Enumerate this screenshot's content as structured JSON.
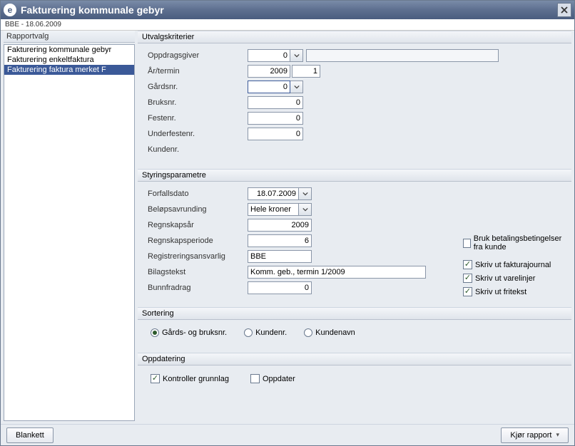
{
  "title": "Fakturering kommunale gebyr",
  "status": "BBE - 18.06.2009",
  "left": {
    "header": "Rapportvalg",
    "items": [
      "Fakturering kommunale gebyr",
      "Fakturering enkeltfaktura",
      "Fakturering faktura merket F"
    ],
    "selected_index": 2
  },
  "utvalg": {
    "title": "Utvalgskriterier",
    "labels": {
      "oppdragsgiver": "Oppdragsgiver",
      "aar_termin": "År/termin",
      "gardsnr": "Gårdsnr.",
      "bruksnr": "Bruksnr.",
      "festenr": "Festenr.",
      "underfestenr": "Underfestenr.",
      "kundenr": "Kundenr."
    },
    "values": {
      "oppdragsgiver": "0",
      "aar": "2009",
      "termin": "1",
      "gardsnr": "0",
      "bruksnr": "0",
      "festenr": "0",
      "underfestenr": "0"
    }
  },
  "styring": {
    "title": "Styringsparametre",
    "labels": {
      "forfallsdato": "Forfallsdato",
      "belopsavrunding": "Beløpsavrunding",
      "regnskapsaar": "Regnskapsår",
      "regnskapsperiode": "Regnskapsperiode",
      "registreringsansvarlig": "Registreringsansvarlig",
      "bilagstekst": "Bilagstekst",
      "bunnfradrag": "Bunnfradrag"
    },
    "values": {
      "forfallsdato": "18.07.2009",
      "belopsavrunding": "Hele kroner",
      "regnskapsaar": "2009",
      "regnskapsperiode": "6",
      "registreringsansvarlig": "BBE",
      "bilagstekst": "Komm. geb., termin 1/2009",
      "bunnfradrag": "0"
    },
    "checks": {
      "bruk_betalingsbetingelser": {
        "label": "Bruk betalingsbetingelser fra kunde",
        "checked": false
      },
      "skriv_ut_fakturajournal": {
        "label": "Skriv ut fakturajournal",
        "checked": true
      },
      "skriv_ut_varelinjer": {
        "label": "Skriv ut varelinjer",
        "checked": true
      },
      "skriv_ut_fritekst": {
        "label": "Skriv ut fritekst",
        "checked": true
      }
    }
  },
  "sortering": {
    "title": "Sortering",
    "options": [
      {
        "label": "Gårds- og bruksnr.",
        "checked": true
      },
      {
        "label": "Kundenr.",
        "checked": false
      },
      {
        "label": "Kundenavn",
        "checked": false
      }
    ]
  },
  "oppdatering": {
    "title": "Oppdatering",
    "kontroller": {
      "label": "Kontroller grunnlag",
      "checked": true
    },
    "oppdater": {
      "label": "Oppdater",
      "checked": false
    }
  },
  "footer": {
    "blankett": "Blankett",
    "kjor": "Kjør rapport"
  }
}
